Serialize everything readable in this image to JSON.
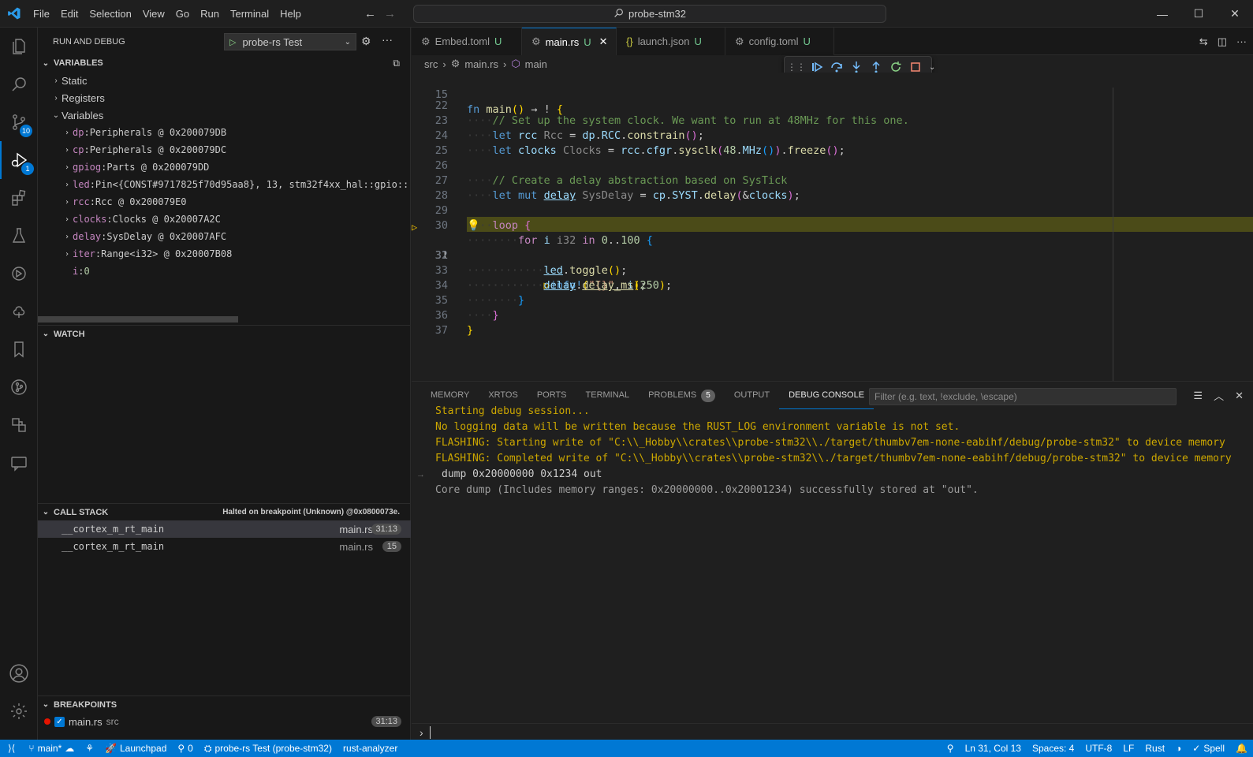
{
  "menu": [
    "File",
    "Edit",
    "Selection",
    "View",
    "Go",
    "Run",
    "Terminal",
    "Help"
  ],
  "command_center": {
    "label": "probe-stm32",
    "icon": "search-icon"
  },
  "activity": {
    "source_control_badge": "10",
    "run_debug_badge": "1"
  },
  "sidebar": {
    "title": "RUN AND DEBUG",
    "launch_config": "probe-rs Test",
    "variables_header": "VARIABLES",
    "groups": {
      "static": "Static",
      "registers": "Registers",
      "variables": "Variables"
    },
    "variables": [
      {
        "name": "dp",
        "value": "Peripherals @ 0x200079DB"
      },
      {
        "name": "cp",
        "value": "Peripherals @ 0x200079DC"
      },
      {
        "name": "gpiog",
        "value": "Parts @ 0x200079DD"
      },
      {
        "name": "led",
        "value": "Pin<{CONST#9717825f70d95aa8}, 13, stm32f4xx_hal::gpio::"
      },
      {
        "name": "rcc",
        "value": "Rcc @ 0x200079E0"
      },
      {
        "name": "clocks",
        "value": "Clocks @ 0x20007A2C"
      },
      {
        "name": "delay",
        "value": "SysDelay @ 0x20007AFC"
      },
      {
        "name": "iter",
        "value": "Range<i32> @ 0x20007B08"
      },
      {
        "name": "i",
        "value": "0"
      }
    ],
    "watch_header": "WATCH",
    "call_stack_header": "CALL STACK",
    "call_stack_status": "Halted on breakpoint (Unknown) @0x0800073e.",
    "call_stack": [
      {
        "name": "__cortex_m_rt_main",
        "file": "main.rs",
        "pos": "31:13"
      },
      {
        "name": "__cortex_m_rt_main",
        "file": "main.rs",
        "pos": "15"
      }
    ],
    "breakpoints_header": "BREAKPOINTS",
    "breakpoints": [
      {
        "file": "main.rs",
        "dir": "src",
        "pos": "31:13"
      }
    ]
  },
  "tabs": [
    {
      "label": "Embed.toml",
      "status": "U",
      "icon": "gear-icon"
    },
    {
      "label": "main.rs",
      "status": "U",
      "icon": "rust-icon"
    },
    {
      "label": "launch.json",
      "status": "U",
      "icon": "json-icon"
    },
    {
      "label": "config.toml",
      "status": "U",
      "icon": "gear-icon"
    }
  ],
  "breadcrumb": [
    "src",
    "main.rs",
    "main"
  ],
  "editor": {
    "line_numbers": [
      "15",
      "22",
      "23",
      "24",
      "25",
      "26",
      "27",
      "28",
      "29",
      "30",
      "31",
      "32",
      "33",
      "34",
      "35",
      "36",
      "37"
    ],
    "current_line": "31"
  },
  "panel": {
    "tabs": [
      "MEMORY",
      "XRTOS",
      "PORTS",
      "TERMINAL",
      "PROBLEMS",
      "OUTPUT",
      "DEBUG CONSOLE"
    ],
    "problems_count": "5",
    "filter_placeholder": "Filter (e.g. text, !exclude, \\escape)",
    "console": [
      "Starting debug session...",
      "No logging data will be written because the RUST_LOG environment variable is not set.",
      "FLASHING: Starting write of \"C:\\\\_Hobby\\\\crates\\\\probe-stm32\\\\./target/thumbv7em-none-eabihf/debug/probe-stm32\" to device memory",
      "FLASHING: Completed write of \"C:\\\\_Hobby\\\\crates\\\\probe-stm32\\\\./target/thumbv7em-none-eabihf/debug/probe-stm32\" to device memory",
      "dump 0x20000000 0x1234 out",
      "Core dump (Includes memory ranges: 0x20000000..0x20001234) successfully stored at \"out\"."
    ]
  },
  "status": {
    "branch": "main*",
    "launchpad": "Launchpad",
    "ports": "0",
    "debug_target": "probe-rs Test (probe-stm32)",
    "analyzer": "rust-analyzer",
    "cursor": "Ln 31, Col 13",
    "spaces": "Spaces: 4",
    "encoding": "UTF-8",
    "eol": "LF",
    "language": "Rust",
    "spell": "Spell"
  },
  "colors": {
    "accent": "#0078d4",
    "status_bar": "#0078d4",
    "warn": "#cca700"
  }
}
